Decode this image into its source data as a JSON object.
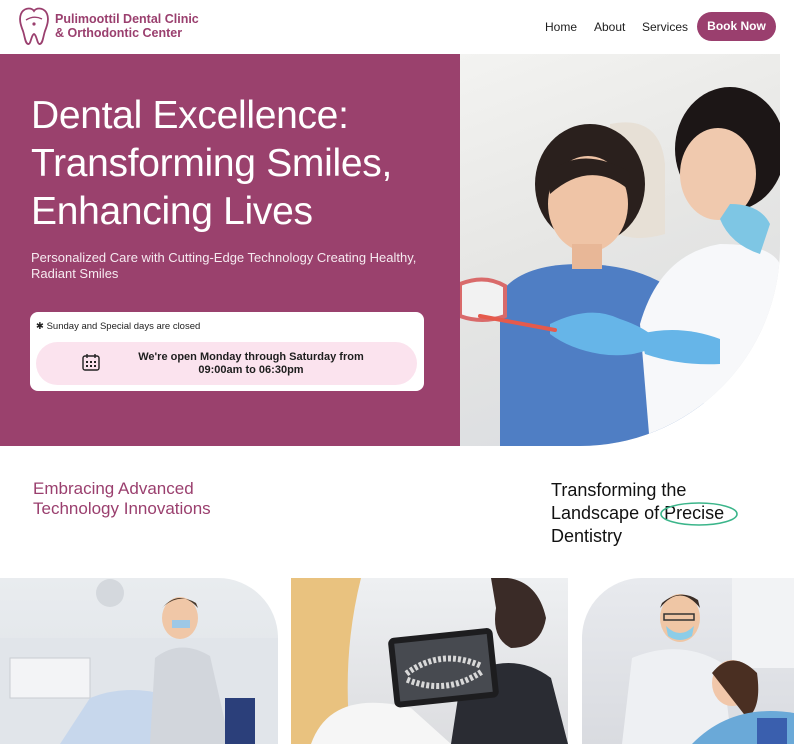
{
  "header": {
    "brand_line1": "Pulimoottil Dental Clinic",
    "brand_line2": "& Orthodontic Center",
    "logo_icon": "tooth-logo-icon",
    "nav": {
      "home": "Home",
      "about": "About",
      "services": "Services"
    },
    "book_label": "Book Now"
  },
  "hero": {
    "title_line1": "Dental Excellence:",
    "title_line2": "Transforming Smiles,",
    "title_line3": "Enhancing Lives",
    "subtitle": "Personalized Care with Cutting-Edge Technology Creating Healthy, Radiant Smiles",
    "closed_note": "✱ Sunday and Special days are closed",
    "hours_line1": "We're open Monday through Saturday from",
    "hours_line2": "09:00am to 06:30pm",
    "calendar_icon": "calendar-icon",
    "photo_icon": "dentist-with-patient-photo"
  },
  "section2": {
    "left_line1": "Embracing Advanced",
    "left_line2": "Technology Innovations",
    "right_line1": "Transforming the",
    "right_line2_prefix": "Landscape of ",
    "right_line2_highlight": "Precise",
    "right_line3": "Dentistry"
  },
  "colors": {
    "brand": "#9a3f6e",
    "hero_bg": "#9a416d",
    "pill_bg": "#fbe3ee",
    "highlight_ring": "#3bb58a"
  }
}
